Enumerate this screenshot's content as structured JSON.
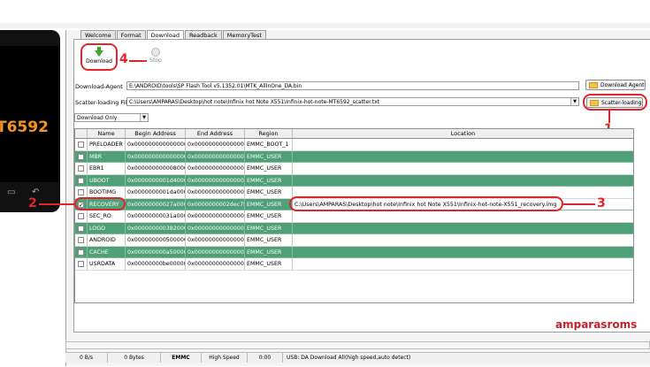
{
  "phone": {
    "chip_text": "T6592"
  },
  "tabs": [
    {
      "label": "Welcome"
    },
    {
      "label": "Format"
    },
    {
      "label": "Download"
    },
    {
      "label": "Readback"
    },
    {
      "label": "MemoryTest"
    }
  ],
  "toolbar": {
    "download_label": "Download",
    "stop_label": "Stop"
  },
  "form": {
    "download_agent_label": "Download-Agent",
    "download_agent_value": "E:\\ANDROID\\tools\\SP Flash Tool v5.1352.01\\MTK_AllInOne_DA.bin",
    "download_agent_button": "Download Agent",
    "scatter_label": "Scatter-loading File",
    "scatter_value": "C:\\Users\\AMPARAS\\Desktop\\hot note\\Infinix hot Note X551\\Infinix-hot-note-MT6592_scatter.txt",
    "scatter_button": "Scatter-loading",
    "mode_value": "Download Only"
  },
  "annotations": {
    "n1": "1",
    "n2": "2",
    "n3": "3",
    "n4": "4"
  },
  "table": {
    "headers": [
      "",
      "Name",
      "Begin Address",
      "End Address",
      "Region",
      "Location"
    ],
    "rows": [
      {
        "checked": false,
        "name": "PRELOADER",
        "begin": "0x0000000000000000",
        "end": "0x0000000000000000",
        "region": "EMMC_BOOT_1",
        "location": ""
      },
      {
        "checked": false,
        "name": "MBR",
        "begin": "0x0000000000000000",
        "end": "0x0000000000000000",
        "region": "EMMC_USER",
        "location": ""
      },
      {
        "checked": false,
        "name": "EBR1",
        "begin": "0x0000000000080000",
        "end": "0x0000000000000000",
        "region": "EMMC_USER",
        "location": ""
      },
      {
        "checked": false,
        "name": "UBOOT",
        "begin": "0x0000000001d40000",
        "end": "0x0000000000000000",
        "region": "EMMC_USER",
        "location": ""
      },
      {
        "checked": false,
        "name": "BOOTIMG",
        "begin": "0x0000000001da0000",
        "end": "0x0000000000000000",
        "region": "EMMC_USER",
        "location": ""
      },
      {
        "checked": true,
        "name": "RECOVERY",
        "begin": "0x00000000027a0000",
        "end": "0x0000000002dec7ff",
        "region": "EMMC_USER",
        "location": "C:\\Users\\AMPARAS\\Desktop\\hot note\\Infinix hot Note X551\\Infinix-hot-note-X551_recovery.img"
      },
      {
        "checked": false,
        "name": "SEC_RO",
        "begin": "0x00000000031a0000",
        "end": "0x0000000000000000",
        "region": "EMMC_USER",
        "location": ""
      },
      {
        "checked": false,
        "name": "LOGO",
        "begin": "0x0000000003820000",
        "end": "0x0000000000000000",
        "region": "EMMC_USER",
        "location": ""
      },
      {
        "checked": false,
        "name": "ANDROID",
        "begin": "0x0000000005000000",
        "end": "0x0000000000000000",
        "region": "EMMC_USER",
        "location": ""
      },
      {
        "checked": false,
        "name": "CACHE",
        "begin": "0x000000000a5000000",
        "end": "0x0000000000000000",
        "region": "EMMC_USER",
        "location": ""
      },
      {
        "checked": false,
        "name": "USRDATA",
        "begin": "0x00000000be000000",
        "end": "0x0000000000000000",
        "region": "EMMC_USER",
        "location": ""
      }
    ]
  },
  "watermark": "amparasroms",
  "status": {
    "speed": "0 B/s",
    "bytes": "0 Bytes",
    "storage": "EMMC",
    "mode": "High Speed",
    "time": "0:00",
    "message": "USB: DA Download All(high speed,auto detect)"
  },
  "colors": {
    "accent_red": "#e0262a",
    "row_green": "#4f9f78"
  }
}
